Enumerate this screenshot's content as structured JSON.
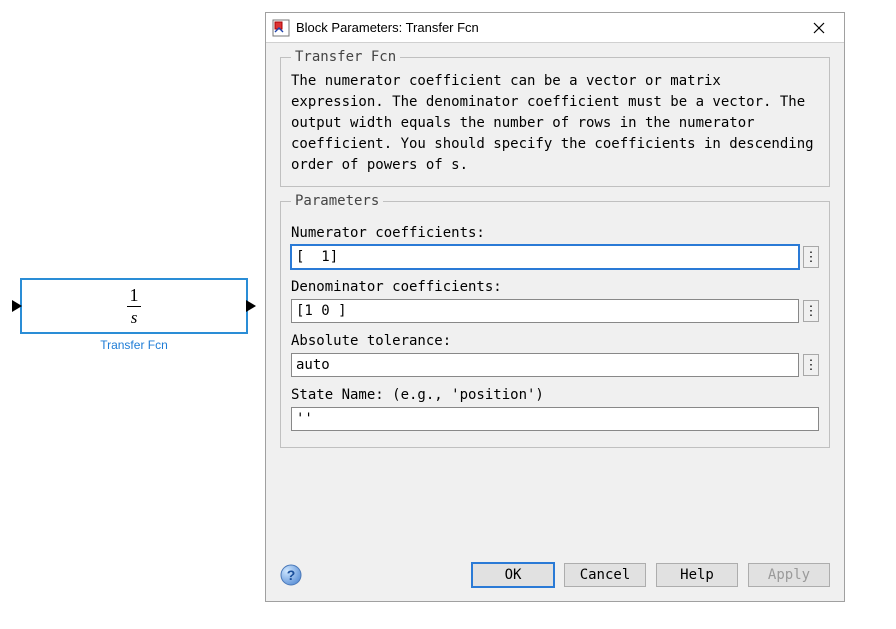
{
  "block": {
    "numerator_display": "1",
    "denominator_display": "s",
    "label": "Transfer Fcn"
  },
  "dialog": {
    "title": "Block Parameters: Transfer Fcn",
    "group1_title": "Transfer Fcn",
    "description": "The numerator coefficient can be a vector or matrix expression. The denominator coefficient must be a vector. The output width equals the number of rows in the numerator coefficient. You should specify the coefficients in descending order of powers of s.",
    "group2_title": "Parameters",
    "fields": {
      "numerator_label": "Numerator coefficients:",
      "numerator_value": "[  1]",
      "denominator_label": "Denominator coefficients:",
      "denominator_value": "[1 0 ]",
      "abstol_label": "Absolute tolerance:",
      "abstol_value": "auto",
      "state_name_label": "State Name: (e.g., 'position')",
      "state_name_value": "''"
    },
    "buttons": {
      "ok": "OK",
      "cancel": "Cancel",
      "help": "Help",
      "apply": "Apply"
    }
  }
}
